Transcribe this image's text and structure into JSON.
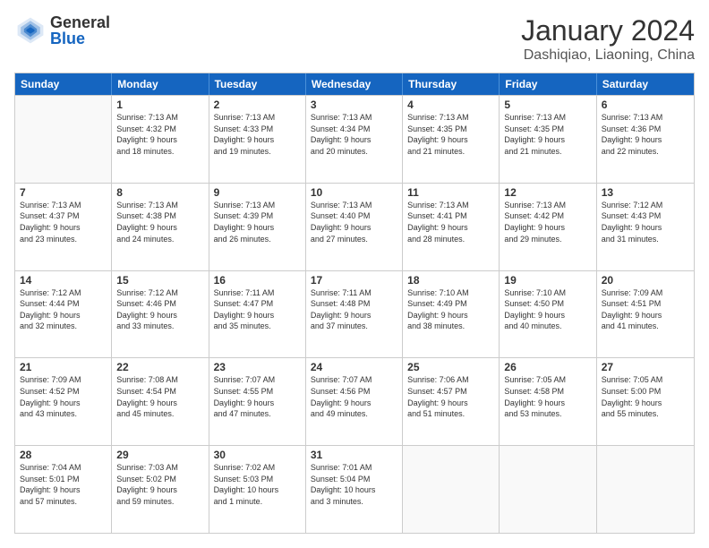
{
  "header": {
    "logo": {
      "general": "General",
      "blue": "Blue"
    },
    "title": "January 2024",
    "subtitle": "Dashiqiao, Liaoning, China"
  },
  "weekdays": [
    "Sunday",
    "Monday",
    "Tuesday",
    "Wednesday",
    "Thursday",
    "Friday",
    "Saturday"
  ],
  "weeks": [
    [
      {
        "day": null,
        "data": null
      },
      {
        "day": "1",
        "data": "Sunrise: 7:13 AM\nSunset: 4:32 PM\nDaylight: 9 hours\nand 18 minutes."
      },
      {
        "day": "2",
        "data": "Sunrise: 7:13 AM\nSunset: 4:33 PM\nDaylight: 9 hours\nand 19 minutes."
      },
      {
        "day": "3",
        "data": "Sunrise: 7:13 AM\nSunset: 4:34 PM\nDaylight: 9 hours\nand 20 minutes."
      },
      {
        "day": "4",
        "data": "Sunrise: 7:13 AM\nSunset: 4:35 PM\nDaylight: 9 hours\nand 21 minutes."
      },
      {
        "day": "5",
        "data": "Sunrise: 7:13 AM\nSunset: 4:35 PM\nDaylight: 9 hours\nand 21 minutes."
      },
      {
        "day": "6",
        "data": "Sunrise: 7:13 AM\nSunset: 4:36 PM\nDaylight: 9 hours\nand 22 minutes."
      }
    ],
    [
      {
        "day": "7",
        "data": "Sunrise: 7:13 AM\nSunset: 4:37 PM\nDaylight: 9 hours\nand 23 minutes."
      },
      {
        "day": "8",
        "data": "Sunrise: 7:13 AM\nSunset: 4:38 PM\nDaylight: 9 hours\nand 24 minutes."
      },
      {
        "day": "9",
        "data": "Sunrise: 7:13 AM\nSunset: 4:39 PM\nDaylight: 9 hours\nand 26 minutes."
      },
      {
        "day": "10",
        "data": "Sunrise: 7:13 AM\nSunset: 4:40 PM\nDaylight: 9 hours\nand 27 minutes."
      },
      {
        "day": "11",
        "data": "Sunrise: 7:13 AM\nSunset: 4:41 PM\nDaylight: 9 hours\nand 28 minutes."
      },
      {
        "day": "12",
        "data": "Sunrise: 7:13 AM\nSunset: 4:42 PM\nDaylight: 9 hours\nand 29 minutes."
      },
      {
        "day": "13",
        "data": "Sunrise: 7:12 AM\nSunset: 4:43 PM\nDaylight: 9 hours\nand 31 minutes."
      }
    ],
    [
      {
        "day": "14",
        "data": "Sunrise: 7:12 AM\nSunset: 4:44 PM\nDaylight: 9 hours\nand 32 minutes."
      },
      {
        "day": "15",
        "data": "Sunrise: 7:12 AM\nSunset: 4:46 PM\nDaylight: 9 hours\nand 33 minutes."
      },
      {
        "day": "16",
        "data": "Sunrise: 7:11 AM\nSunset: 4:47 PM\nDaylight: 9 hours\nand 35 minutes."
      },
      {
        "day": "17",
        "data": "Sunrise: 7:11 AM\nSunset: 4:48 PM\nDaylight: 9 hours\nand 37 minutes."
      },
      {
        "day": "18",
        "data": "Sunrise: 7:10 AM\nSunset: 4:49 PM\nDaylight: 9 hours\nand 38 minutes."
      },
      {
        "day": "19",
        "data": "Sunrise: 7:10 AM\nSunset: 4:50 PM\nDaylight: 9 hours\nand 40 minutes."
      },
      {
        "day": "20",
        "data": "Sunrise: 7:09 AM\nSunset: 4:51 PM\nDaylight: 9 hours\nand 41 minutes."
      }
    ],
    [
      {
        "day": "21",
        "data": "Sunrise: 7:09 AM\nSunset: 4:52 PM\nDaylight: 9 hours\nand 43 minutes."
      },
      {
        "day": "22",
        "data": "Sunrise: 7:08 AM\nSunset: 4:54 PM\nDaylight: 9 hours\nand 45 minutes."
      },
      {
        "day": "23",
        "data": "Sunrise: 7:07 AM\nSunset: 4:55 PM\nDaylight: 9 hours\nand 47 minutes."
      },
      {
        "day": "24",
        "data": "Sunrise: 7:07 AM\nSunset: 4:56 PM\nDaylight: 9 hours\nand 49 minutes."
      },
      {
        "day": "25",
        "data": "Sunrise: 7:06 AM\nSunset: 4:57 PM\nDaylight: 9 hours\nand 51 minutes."
      },
      {
        "day": "26",
        "data": "Sunrise: 7:05 AM\nSunset: 4:58 PM\nDaylight: 9 hours\nand 53 minutes."
      },
      {
        "day": "27",
        "data": "Sunrise: 7:05 AM\nSunset: 5:00 PM\nDaylight: 9 hours\nand 55 minutes."
      }
    ],
    [
      {
        "day": "28",
        "data": "Sunrise: 7:04 AM\nSunset: 5:01 PM\nDaylight: 9 hours\nand 57 minutes."
      },
      {
        "day": "29",
        "data": "Sunrise: 7:03 AM\nSunset: 5:02 PM\nDaylight: 9 hours\nand 59 minutes."
      },
      {
        "day": "30",
        "data": "Sunrise: 7:02 AM\nSunset: 5:03 PM\nDaylight: 10 hours\nand 1 minute."
      },
      {
        "day": "31",
        "data": "Sunrise: 7:01 AM\nSunset: 5:04 PM\nDaylight: 10 hours\nand 3 minutes."
      },
      {
        "day": null,
        "data": null
      },
      {
        "day": null,
        "data": null
      },
      {
        "day": null,
        "data": null
      }
    ]
  ]
}
